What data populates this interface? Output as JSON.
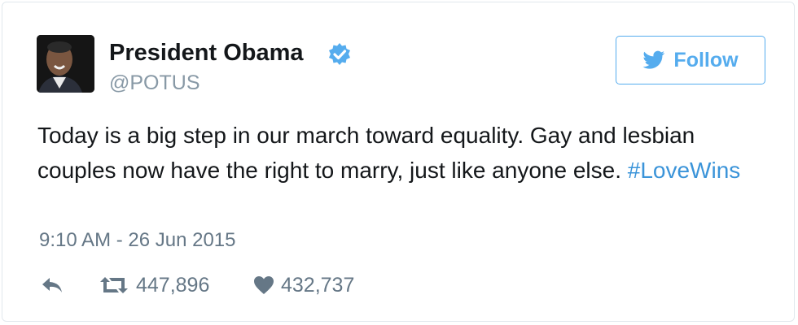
{
  "user": {
    "name": "President Obama",
    "handle": "@POTUS",
    "verified": true,
    "avatar": "user-photo"
  },
  "follow_button": {
    "label": "Follow",
    "icon": "twitter-bird-icon",
    "color": "#55acee"
  },
  "tweet": {
    "text": "Today is a big step in our march toward equality. Gay and lesbian couples now have the right to marry, just like anyone else. ",
    "hashtag": "#LoveWins",
    "timestamp": "9:10 AM - 26 Jun 2015"
  },
  "actions": {
    "reply": {
      "icon": "reply-icon"
    },
    "retweet": {
      "icon": "retweet-icon",
      "count": "447,896"
    },
    "like": {
      "icon": "heart-icon",
      "count": "432,737"
    }
  },
  "colors": {
    "hashtag": "#3b94d9",
    "muted": "#657786",
    "verified": "#55acee"
  }
}
